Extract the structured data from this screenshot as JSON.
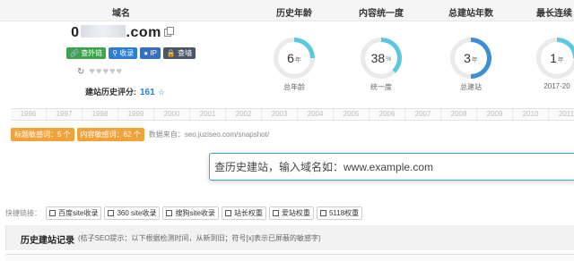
{
  "header": {
    "columns": [
      "域名",
      "历史年龄",
      "内容统一度",
      "总建站年数",
      "最长连续"
    ]
  },
  "domain": {
    "prefix": "0",
    "suffix": ".com"
  },
  "tags": [
    {
      "label": "查外链",
      "icon": "link-icon"
    },
    {
      "label": "收录",
      "icon": "search-icon"
    },
    {
      "label": "IP",
      "icon": "location-icon"
    },
    {
      "label": "查墙",
      "icon": "lock-icon"
    }
  ],
  "rating": {
    "label": "建站历史评分:",
    "value": "161",
    "hearts_filled": 0,
    "hearts_total": 5
  },
  "stats": [
    {
      "value": "6",
      "unit": "年",
      "label": "总年龄",
      "fraction": 0.25,
      "color": "#5ac8e0"
    },
    {
      "value": "38",
      "unit": "%",
      "label": "统一度",
      "fraction": 0.38,
      "color": "#5ac8e0"
    },
    {
      "value": "3",
      "unit": "年",
      "label": "总建站",
      "fraction": 0.5,
      "color": "#3a8fd6"
    },
    {
      "value": "1",
      "unit": "年",
      "label": "2017-20",
      "fraction": 0.25,
      "color": "#5ac8e0"
    }
  ],
  "years": [
    "1996",
    "1997",
    "1998",
    "1999",
    "2000",
    "2001",
    "2002",
    "2003",
    "2004",
    "2005",
    "2006",
    "2007",
    "2008",
    "2009",
    "2010",
    "2011"
  ],
  "sensitive": {
    "title_badge": "标题敏感词：5 个",
    "content_badge": "内容敏感词：62 个",
    "source": "数据来自：seo.juziseo.com/snapshot/"
  },
  "search": {
    "placeholder": "查历史建站，输入域名如：www.example.com"
  },
  "quick_links": {
    "label": "快捷链接：",
    "items": [
      "百度site收录",
      "360 site收录",
      "搜狗site收录",
      "站长权重",
      "爱站权重",
      "5118权重"
    ]
  },
  "history": {
    "title": "历史建站记录",
    "hint": "(桔子SEO提示：以下根据检测时间，从新到旧；符号[x]表示已屏蔽的敏感字)"
  },
  "colors": {
    "accent": "#2b7fd4",
    "ring_light": "#5ac8e0",
    "ring_track": "#eaeaea",
    "badge_orange": "#f0a33c"
  }
}
